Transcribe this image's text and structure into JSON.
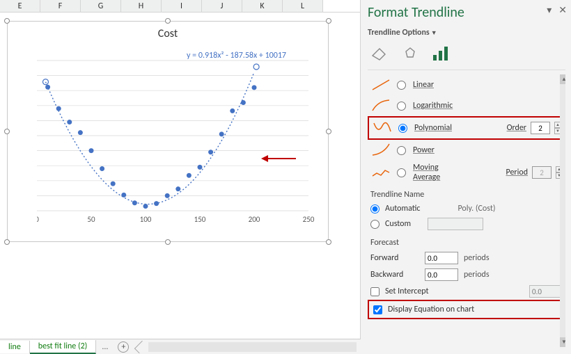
{
  "columns": [
    "E",
    "F",
    "G",
    "H",
    "I",
    "J",
    "K",
    "L"
  ],
  "chart": {
    "title": "Cost",
    "equation": "y = 0.918x² - 187.58x + 10017"
  },
  "chart_data": {
    "type": "scatter",
    "title": "Cost",
    "xlabel": "",
    "ylabel": "",
    "xlim": [
      0,
      250
    ],
    "ylim": [
      0,
      10000
    ],
    "x_ticks": [
      0,
      50,
      100,
      150,
      200,
      250
    ],
    "y_ticks": [
      0,
      1000,
      2000,
      3000,
      4000,
      5000,
      6000,
      7000,
      8000,
      9000,
      10000
    ],
    "series": [
      {
        "name": "Cost",
        "x": [
          10,
          20,
          30,
          40,
          50,
          60,
          70,
          80,
          90,
          100,
          110,
          120,
          130,
          140,
          150,
          160,
          170,
          180,
          190,
          200
        ],
        "values": [
          8230,
          6800,
          5900,
          5200,
          4000,
          2800,
          1800,
          1050,
          520,
          300,
          480,
          1000,
          1450,
          2350,
          2900,
          3900,
          5100,
          6650,
          7200,
          8200
        ]
      }
    ],
    "trendline": {
      "type": "polynomial",
      "order": 2,
      "equation": "y = 0.918x^2 - 187.58x + 10017"
    }
  },
  "tabs": {
    "active": "line",
    "items": [
      "line",
      "best fit line (2)"
    ],
    "ellipsis": "...",
    "add": "+"
  },
  "pane": {
    "title": "Format Trendline",
    "section": "Trendline Options",
    "types": {
      "linear": "Linear",
      "logarithmic": "Logarithmic",
      "polynomial": "Polynomial",
      "power": "Power",
      "moving_average_l1": "Moving",
      "moving_average_l2": "Average",
      "order_label": "Order",
      "order_value": "2",
      "period_label": "Period",
      "period_value": "2"
    },
    "name": {
      "header": "Trendline Name",
      "automatic": "Automatic",
      "auto_value": "Poly. (Cost)",
      "custom": "Custom"
    },
    "forecast": {
      "header": "Forecast",
      "forward": "Forward",
      "backward": "Backward",
      "fval": "0.0",
      "bval": "0.0",
      "unit": "periods"
    },
    "intercept": {
      "label": "Set Intercept",
      "value": "0.0"
    },
    "display_eq": "Display Equation on chart"
  }
}
